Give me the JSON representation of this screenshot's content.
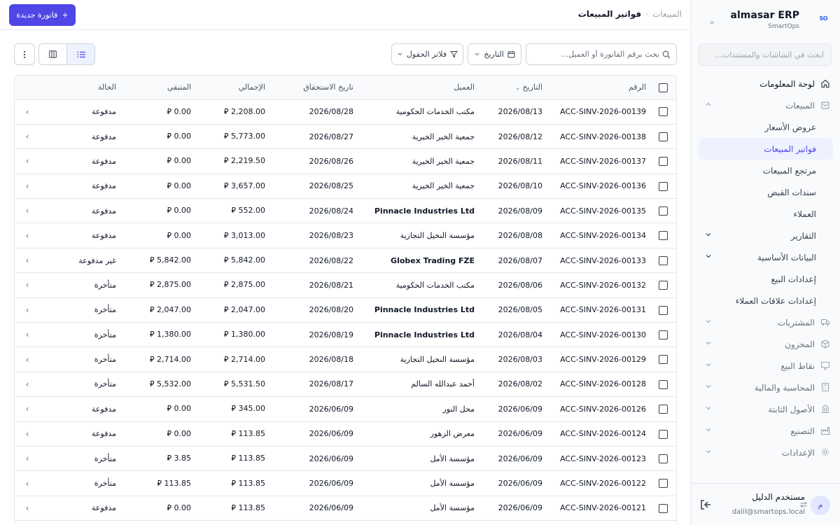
{
  "app": {
    "name": "almasar ERP",
    "subtitle": "SmartOps",
    "logo_text": "SO"
  },
  "sidebar": {
    "search_placeholder": "ابحث في الشاشات والمستندات...",
    "items": [
      {
        "label": "لوحة المعلومات",
        "icon": "home-icon",
        "style": "bold",
        "chevron": ""
      },
      {
        "label": "المبيعات",
        "icon": "cart-icon",
        "style": "muted",
        "chevron": "up"
      },
      {
        "label": "عروض الأسعار",
        "icon": "",
        "style": "sub",
        "chevron": ""
      },
      {
        "label": "فواتير المبيعات",
        "icon": "",
        "style": "sub active",
        "chevron": ""
      },
      {
        "label": "مرتجع المبيعات",
        "icon": "",
        "style": "sub",
        "chevron": ""
      },
      {
        "label": "سندات القبض",
        "icon": "",
        "style": "sub",
        "chevron": ""
      },
      {
        "label": "العملاء",
        "icon": "",
        "style": "sub",
        "chevron": ""
      },
      {
        "label": "التقارير",
        "icon": "",
        "style": "sub",
        "chevron": "down"
      },
      {
        "label": "البيانات الأساسية",
        "icon": "",
        "style": "sub",
        "chevron": "down"
      },
      {
        "label": "إعدادات البيع",
        "icon": "",
        "style": "sub",
        "chevron": ""
      },
      {
        "label": "إعدادات علاقات العملاء",
        "icon": "",
        "style": "sub",
        "chevron": ""
      },
      {
        "label": "المشتريات",
        "icon": "truck-icon",
        "style": "muted",
        "chevron": "down"
      },
      {
        "label": "المخزون",
        "icon": "box-icon",
        "style": "muted",
        "chevron": "down"
      },
      {
        "label": "نقاط البيع",
        "icon": "monitor-icon",
        "style": "muted",
        "chevron": "down"
      },
      {
        "label": "المحاسبة والمالية",
        "icon": "calculator-icon",
        "style": "muted",
        "chevron": "down"
      },
      {
        "label": "الأصول الثابتة",
        "icon": "building-icon",
        "style": "muted",
        "chevron": "down"
      },
      {
        "label": "التصنيع",
        "icon": "factory-icon",
        "style": "muted",
        "chevron": "down"
      },
      {
        "label": "الإعدادات",
        "icon": "gear-icon",
        "style": "muted",
        "chevron": "down"
      }
    ]
  },
  "user": {
    "avatar_initial": "م",
    "name": "مستخدم الدليل",
    "email": "dalil@smartops.local"
  },
  "header": {
    "breadcrumb_parent": "المبيعات",
    "breadcrumb_current": "فواتير المبيعات",
    "new_button_label": "فاتورة جديدة"
  },
  "toolbar": {
    "search_placeholder": "بحث برقم الفاتورة أو العميل...",
    "date_button": "التاريخ",
    "filter_button": "فلاتر الحقول"
  },
  "table": {
    "columns": {
      "number": "الرقم",
      "date": "التاريخ",
      "customer": "العميل",
      "due_date": "تاريخ الاستحقاق",
      "total": "الإجمالي",
      "remaining": "المتبقي",
      "status": "الحالة"
    },
    "rows": [
      {
        "number": "ACC-SINV-2026-00139",
        "date": "2026/08/13",
        "customer": "مكتب الخدمات الحكومية",
        "due": "2026/08/28",
        "total": "2,208.00 ⃁",
        "remaining": "0.00 ⃁",
        "status": "مدفوعة"
      },
      {
        "number": "ACC-SINV-2026-00138",
        "date": "2026/08/12",
        "customer": "جمعية الخير الخيرية",
        "due": "2026/08/27",
        "total": "5,773.00 ⃁",
        "remaining": "0.00 ⃁",
        "status": "مدفوعة"
      },
      {
        "number": "ACC-SINV-2026-00137",
        "date": "2026/08/11",
        "customer": "جمعية الخير الخيرية",
        "due": "2026/08/26",
        "total": "2,219.50 ⃁",
        "remaining": "0.00 ⃁",
        "status": "مدفوعة"
      },
      {
        "number": "ACC-SINV-2026-00136",
        "date": "2026/08/10",
        "customer": "جمعية الخير الخيرية",
        "due": "2026/08/25",
        "total": "3,657.00 ⃁",
        "remaining": "0.00 ⃁",
        "status": "مدفوعة"
      },
      {
        "number": "ACC-SINV-2026-00135",
        "date": "2026/08/09",
        "customer": "Pinnacle Industries Ltd",
        "due": "2026/08/24",
        "total": "552.00 ⃁",
        "remaining": "0.00 ⃁",
        "status": "مدفوعة"
      },
      {
        "number": "ACC-SINV-2026-00134",
        "date": "2026/08/08",
        "customer": "مؤسسة النخيل التجارية",
        "due": "2026/08/23",
        "total": "3,013.00 ⃁",
        "remaining": "0.00 ⃁",
        "status": "مدفوعة"
      },
      {
        "number": "ACC-SINV-2026-00133",
        "date": "2026/08/07",
        "customer": "Globex Trading FZE",
        "due": "2026/08/22",
        "total": "5,842.00 ⃁",
        "remaining": "5,842.00 ⃁",
        "status": "غير مدفوعة"
      },
      {
        "number": "ACC-SINV-2026-00132",
        "date": "2026/08/06",
        "customer": "مكتب الخدمات الحكومية",
        "due": "2026/08/21",
        "total": "2,875.00 ⃁",
        "remaining": "2,875.00 ⃁",
        "status": "متأخرة"
      },
      {
        "number": "ACC-SINV-2026-00131",
        "date": "2026/08/05",
        "customer": "Pinnacle Industries Ltd",
        "due": "2026/08/20",
        "total": "2,047.00 ⃁",
        "remaining": "2,047.00 ⃁",
        "status": "متأخرة"
      },
      {
        "number": "ACC-SINV-2026-00130",
        "date": "2026/08/04",
        "customer": "Pinnacle Industries Ltd",
        "due": "2026/08/19",
        "total": "1,380.00 ⃁",
        "remaining": "1,380.00 ⃁",
        "status": "متأخرة"
      },
      {
        "number": "ACC-SINV-2026-00129",
        "date": "2026/08/03",
        "customer": "مؤسسة النخيل التجارية",
        "due": "2026/08/18",
        "total": "2,714.00 ⃁",
        "remaining": "2,714.00 ⃁",
        "status": "متأخرة"
      },
      {
        "number": "ACC-SINV-2026-00128",
        "date": "2026/08/02",
        "customer": "أحمد عبدالله السالم",
        "due": "2026/08/17",
        "total": "5,531.50 ⃁",
        "remaining": "5,532.00 ⃁",
        "status": "متأخرة"
      },
      {
        "number": "ACC-SINV-2026-00126",
        "date": "2026/06/09",
        "customer": "محل النور",
        "due": "2026/06/09",
        "total": "345.00 ⃁",
        "remaining": "0.00 ⃁",
        "status": "مدفوعة"
      },
      {
        "number": "ACC-SINV-2026-00124",
        "date": "2026/06/09",
        "customer": "معرض الزهور",
        "due": "2026/06/09",
        "total": "113.85 ⃁",
        "remaining": "0.00 ⃁",
        "status": "مدفوعة"
      },
      {
        "number": "ACC-SINV-2026-00123",
        "date": "2026/06/09",
        "customer": "مؤسسة الأمل",
        "due": "2026/06/09",
        "total": "113.85 ⃁",
        "remaining": "3.85 ⃁",
        "status": "متأخرة"
      },
      {
        "number": "ACC-SINV-2026-00122",
        "date": "2026/06/09",
        "customer": "مؤسسة الأمل",
        "due": "2026/06/09",
        "total": "113.85 ⃁",
        "remaining": "113.85 ⃁",
        "status": "متأخرة"
      },
      {
        "number": "ACC-SINV-2026-00121",
        "date": "2026/06/09",
        "customer": "مؤسسة الأمل",
        "due": "2026/06/09",
        "total": "113.85 ⃁",
        "remaining": "0.00 ⃁",
        "status": "مدفوعة"
      }
    ]
  },
  "colors": {
    "accent": "#4f46e5",
    "accent_light": "#eef2ff"
  }
}
